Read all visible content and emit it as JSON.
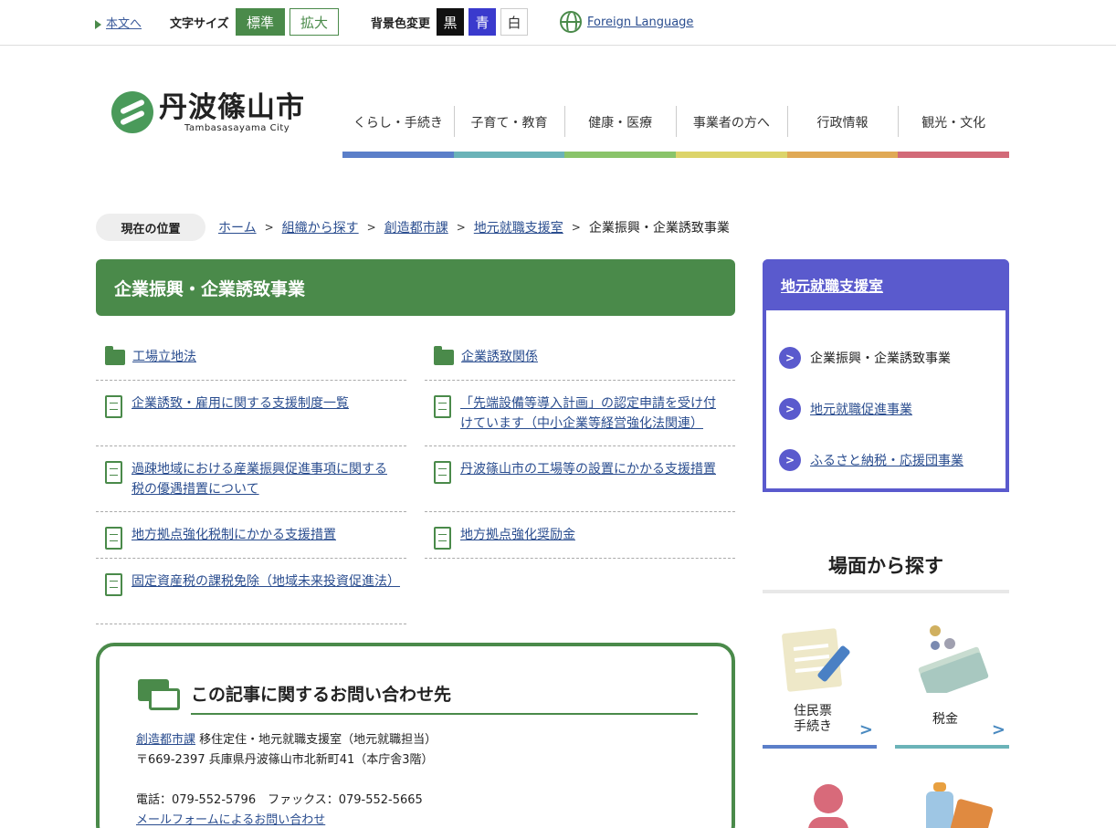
{
  "utility": {
    "skip_label": "本文へ",
    "font_size_label": "文字サイズ",
    "font_standard": "標準",
    "font_large": "拡大",
    "bg_label": "背景色変更",
    "bg_black": "黒",
    "bg_blue": "青",
    "bg_white": "白",
    "foreign": "Foreign Language"
  },
  "logo": {
    "jp": "丹波篠山市",
    "en": "Tambasasayama City"
  },
  "gnav": [
    {
      "label": "くらし・手続き",
      "color": "#5b7fc9"
    },
    {
      "label": "子育て・教育",
      "color": "#6bb3b8"
    },
    {
      "label": "健康・医療",
      "color": "#8ac46a"
    },
    {
      "label": "事業者の方へ",
      "color": "#dcd46a"
    },
    {
      "label": "行政情報",
      "color": "#e0a955"
    },
    {
      "label": "観光・文化",
      "color": "#d26a78"
    }
  ],
  "breadcrumb": {
    "here": "現在の位置",
    "items": [
      "ホーム",
      "組織から探す",
      "創造都市課",
      "地元就職支援室"
    ],
    "current": "企業振興・企業誘致事業"
  },
  "page_title": "企業振興・企業誘致事業",
  "links_left": [
    {
      "type": "folder",
      "text": "工場立地法"
    },
    {
      "type": "doc",
      "text": "企業誘致・雇用に関する支援制度一覧"
    },
    {
      "type": "doc",
      "text": "過疎地域における産業振興促進事項に関する税の優遇措置について"
    },
    {
      "type": "doc",
      "text": "地方拠点強化税制にかかる支援措置"
    },
    {
      "type": "doc",
      "text": "固定資産税の課税免除（地域未来投資促進法）"
    }
  ],
  "links_right": [
    {
      "type": "folder",
      "text": "企業誘致関係"
    },
    {
      "type": "doc",
      "text": "「先端設備等導入計画」の認定申請を受け付けています（中小企業等経営強化法関連）"
    },
    {
      "type": "doc",
      "text": "丹波篠山市の工場等の設置にかかる支援措置"
    },
    {
      "type": "doc",
      "text": "地方拠点強化奨励金"
    }
  ],
  "inquiry": {
    "title": "この記事に関するお問い合わせ先",
    "dept_link": "創造都市課",
    "dept_rest": " 移住定住・地元就職支援室（地元就職担当）",
    "address": "〒669-2397 兵庫県丹波篠山市北新町41（本庁舎3階）",
    "tel_fax": "電話：079-552-5796　ファックス：079-552-5665",
    "mail": "メールフォームによるお問い合わせ"
  },
  "sidebar": {
    "title": "地元就職支援室",
    "items": [
      {
        "label": "企業振興・企業誘致事業",
        "link": false
      },
      {
        "label": "地元就職促進事業",
        "link": true
      },
      {
        "label": "ふるさと納税・応援団事業",
        "link": true
      }
    ]
  },
  "scenes": {
    "title": "場面から探す",
    "tiles": [
      {
        "label1": "住民票",
        "label2": "手続き",
        "color": "#5b7fc9"
      },
      {
        "label1": "税金",
        "label2": "",
        "color": "#6bb3b8"
      }
    ]
  }
}
